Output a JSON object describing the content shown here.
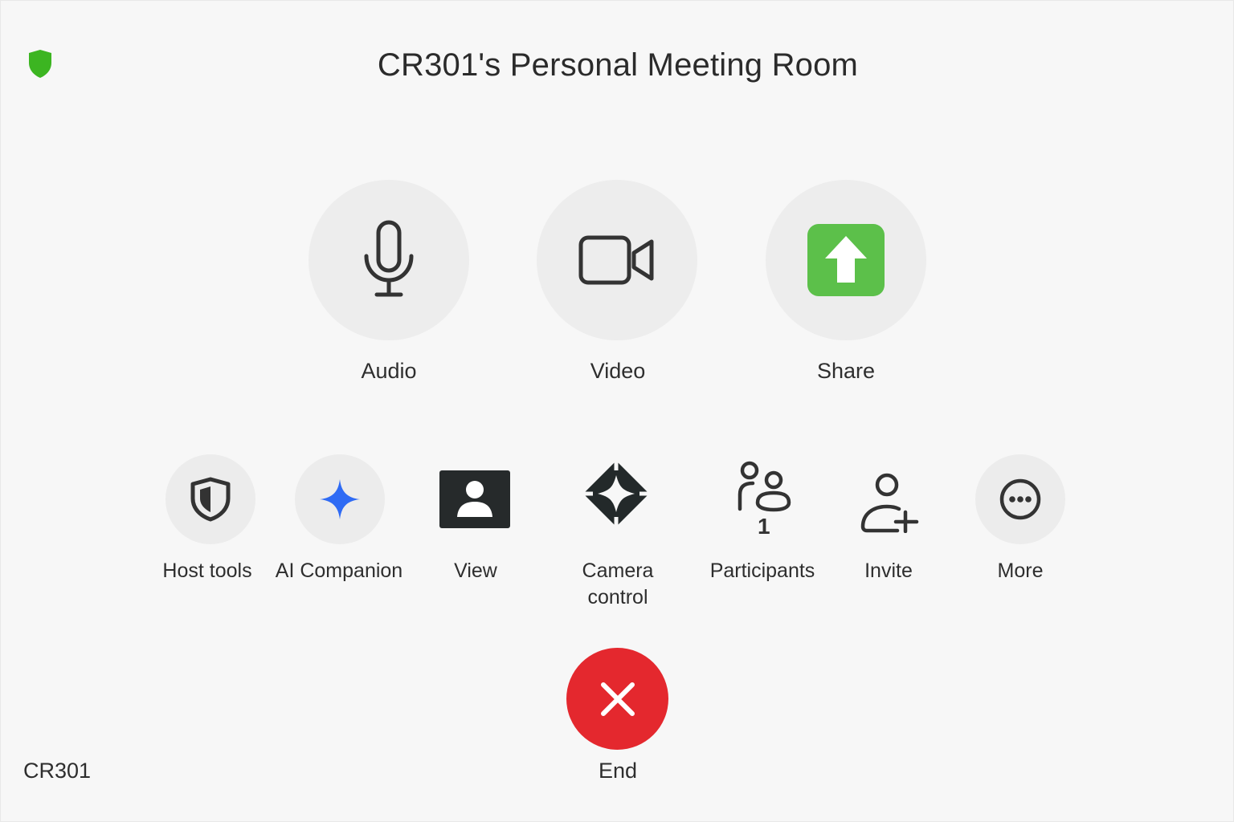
{
  "header": {
    "title": "CR301's Personal Meeting Room",
    "security_icon": "shield-icon",
    "security_color": "#3cb521"
  },
  "main_controls": [
    {
      "label": "Audio",
      "icon": "microphone-icon"
    },
    {
      "label": "Video",
      "icon": "video-camera-icon"
    },
    {
      "label": "Share",
      "icon": "share-screen-icon",
      "color": "#5cc04a"
    }
  ],
  "secondary_controls": [
    {
      "label": "Host tools",
      "icon": "host-tools-shield-icon"
    },
    {
      "label": "AI Companion",
      "icon": "ai-sparkle-icon",
      "color": "#2f6bf4"
    },
    {
      "label": "View",
      "icon": "view-icon"
    },
    {
      "label": "Camera\ncontrol",
      "icon": "camera-control-icon"
    },
    {
      "label": "Participants",
      "icon": "participants-icon",
      "count": "1"
    },
    {
      "label": "Invite",
      "icon": "invite-icon"
    },
    {
      "label": "More",
      "icon": "more-icon"
    }
  ],
  "end": {
    "label": "End",
    "icon": "close-icon",
    "color": "#e4282e"
  },
  "footer": {
    "room_name": "CR301"
  }
}
